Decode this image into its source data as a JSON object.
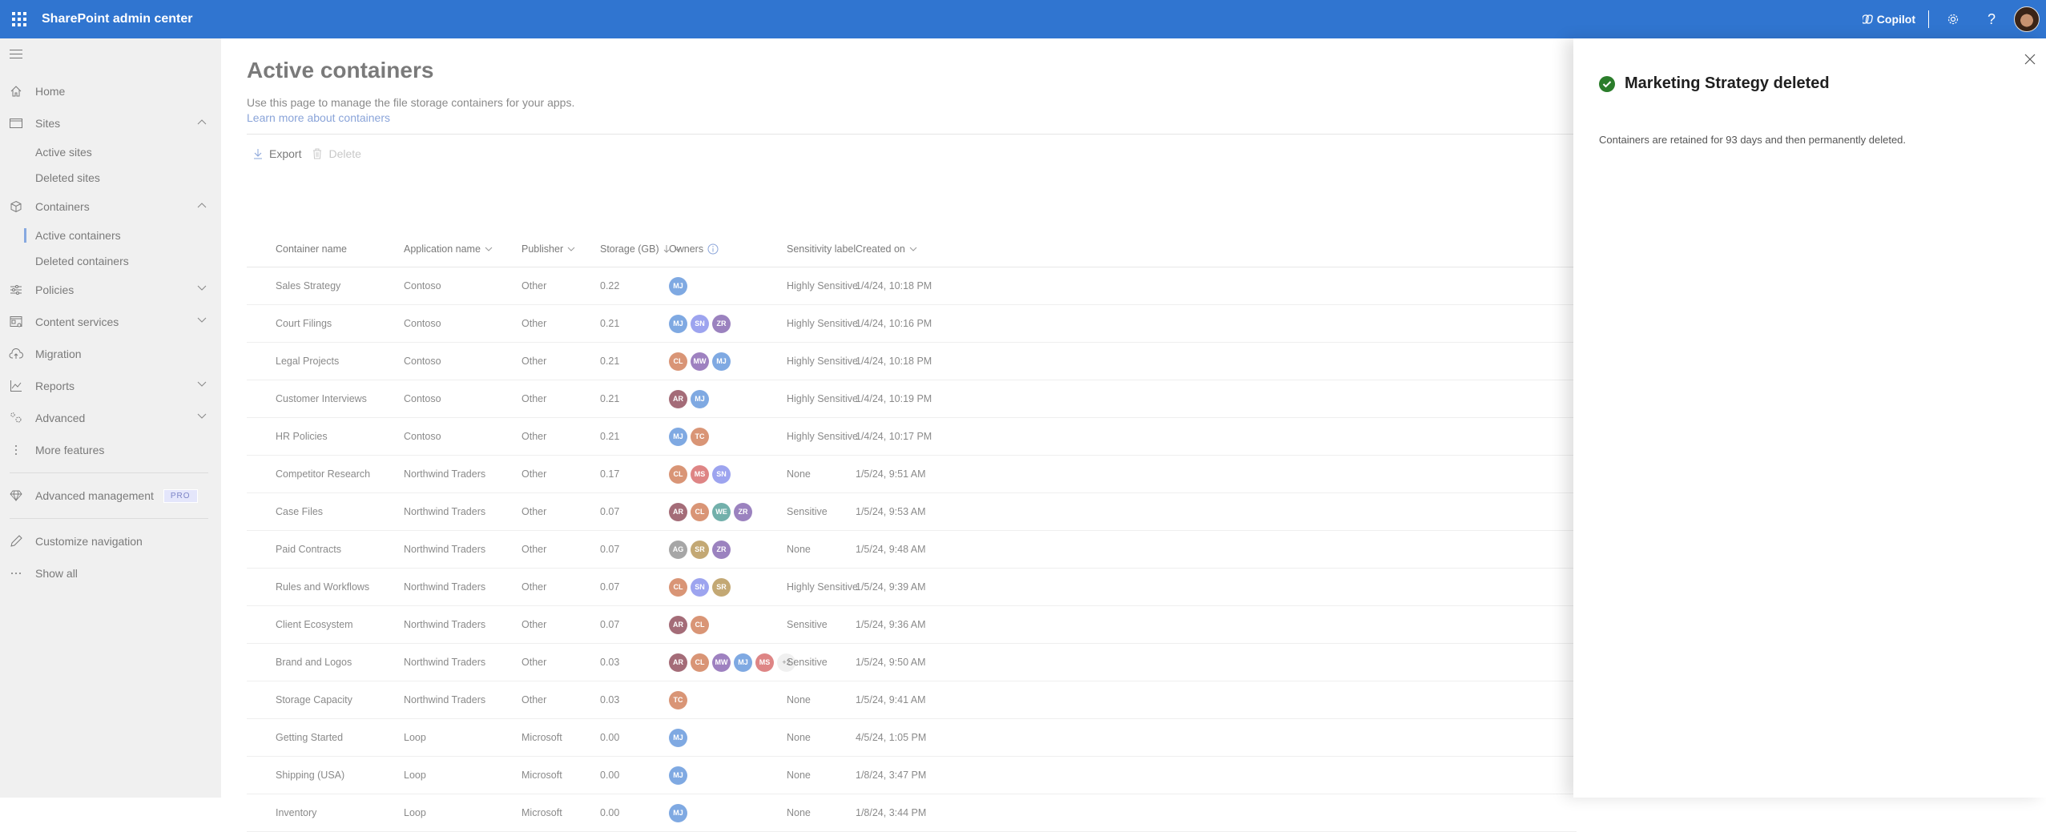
{
  "header": {
    "app_title": "SharePoint admin center",
    "copilot_label": "Copilot",
    "icons": [
      "app-launcher-icon",
      "copilot-icon",
      "settings-icon",
      "help-icon",
      "user-avatar"
    ],
    "brand_color": "#3075d0"
  },
  "sidebar": {
    "items": [
      {
        "label": "Home",
        "icon": "home-icon"
      },
      {
        "label": "Sites",
        "icon": "sites-icon",
        "expanded": true,
        "children": [
          {
            "label": "Active sites"
          },
          {
            "label": "Deleted sites"
          }
        ]
      },
      {
        "label": "Containers",
        "icon": "containers-icon",
        "expanded": true,
        "children": [
          {
            "label": "Active containers",
            "active": true
          },
          {
            "label": "Deleted containers"
          }
        ]
      },
      {
        "label": "Policies",
        "icon": "policies-icon",
        "expanded": false
      },
      {
        "label": "Content services",
        "icon": "content-services-icon",
        "expanded": false
      },
      {
        "label": "Migration",
        "icon": "migration-icon"
      },
      {
        "label": "Reports",
        "icon": "reports-icon",
        "expanded": false
      },
      {
        "label": "Advanced",
        "icon": "advanced-icon",
        "expanded": false
      },
      {
        "label": "More features",
        "icon": "more-features-icon"
      }
    ],
    "advanced_management": {
      "label": "Advanced management",
      "badge": "PRO"
    },
    "customize_navigation": "Customize navigation",
    "show_all": "Show all"
  },
  "main": {
    "title": "Active containers",
    "description": "Use this page to manage the file storage containers for your apps.",
    "learn_link": "Learn more about containers",
    "toolbar": {
      "export_label": "Export",
      "delete_label": "Delete"
    },
    "columns": {
      "name": "Container name",
      "app": "Application name",
      "publisher": "Publisher",
      "storage": "Storage (GB)",
      "owners": "Owners",
      "sensitivity": "Sensitivity label",
      "created": "Created on"
    },
    "rows": [
      {
        "name": "Sales Strategy",
        "app": "Contoso",
        "publisher": "Other",
        "storage": "0.22",
        "owners": [
          "MJ"
        ],
        "sensitivity": "Highly Sensitive",
        "created": "1/4/24, 10:18 PM"
      },
      {
        "name": "Court Filings",
        "app": "Contoso",
        "publisher": "Other",
        "storage": "0.21",
        "owners": [
          "MJ",
          "SN",
          "ZR"
        ],
        "sensitivity": "Highly Sensitive",
        "created": "1/4/24, 10:16 PM"
      },
      {
        "name": "Legal Projects",
        "app": "Contoso",
        "publisher": "Other",
        "storage": "0.21",
        "owners": [
          "CL",
          "MW",
          "MJ"
        ],
        "sensitivity": "Highly Sensitive",
        "created": "1/4/24, 10:18 PM"
      },
      {
        "name": "Customer Interviews",
        "app": "Contoso",
        "publisher": "Other",
        "storage": "0.21",
        "owners": [
          "AR",
          "MJ"
        ],
        "sensitivity": "Highly Sensitive",
        "created": "1/4/24, 10:19 PM"
      },
      {
        "name": "HR Policies",
        "app": "Contoso",
        "publisher": "Other",
        "storage": "0.21",
        "owners": [
          "MJ",
          "TC"
        ],
        "sensitivity": "Highly Sensitive",
        "created": "1/4/24, 10:17 PM"
      },
      {
        "name": "Competitor Research",
        "app": "Northwind Traders",
        "publisher": "Other",
        "storage": "0.17",
        "owners": [
          "CL",
          "MS",
          "SN"
        ],
        "sensitivity": "None",
        "created": "1/5/24, 9:51 AM"
      },
      {
        "name": "Case Files",
        "app": "Northwind Traders",
        "publisher": "Other",
        "storage": "0.07",
        "owners": [
          "AR",
          "CL",
          "WE",
          "ZR"
        ],
        "sensitivity": "Sensitive",
        "created": "1/5/24, 9:53 AM"
      },
      {
        "name": "Paid Contracts",
        "app": "Northwind Traders",
        "publisher": "Other",
        "storage": "0.07",
        "owners": [
          "AG",
          "SR",
          "ZR"
        ],
        "sensitivity": "None",
        "created": "1/5/24, 9:48 AM"
      },
      {
        "name": "Rules and Workflows",
        "app": "Northwind Traders",
        "publisher": "Other",
        "storage": "0.07",
        "owners": [
          "CL",
          "SN",
          "SR"
        ],
        "sensitivity": "Highly Sensitive",
        "created": "1/5/24, 9:39 AM"
      },
      {
        "name": "Client Ecosystem",
        "app": "Northwind Traders",
        "publisher": "Other",
        "storage": "0.07",
        "owners": [
          "AR",
          "CL"
        ],
        "sensitivity": "Sensitive",
        "created": "1/5/24, 9:36 AM"
      },
      {
        "name": "Brand and Logos",
        "app": "Northwind Traders",
        "publisher": "Other",
        "storage": "0.03",
        "owners": [
          "AR",
          "CL",
          "MW",
          "MJ",
          "MS"
        ],
        "owners_more": "+2",
        "sensitivity": "Sensitive",
        "created": "1/5/24, 9:50 AM"
      },
      {
        "name": "Storage Capacity",
        "app": "Northwind Traders",
        "publisher": "Other",
        "storage": "0.03",
        "owners": [
          "TC"
        ],
        "sensitivity": "None",
        "created": "1/5/24, 9:41 AM"
      },
      {
        "name": "Getting Started",
        "app": "Loop",
        "publisher": "Microsoft",
        "storage": "0.00",
        "owners": [
          "MJ"
        ],
        "sensitivity": "None",
        "created": "4/5/24, 1:05 PM"
      },
      {
        "name": "Shipping (USA)",
        "app": "Loop",
        "publisher": "Microsoft",
        "storage": "0.00",
        "owners": [
          "MJ"
        ],
        "sensitivity": "None",
        "created": "1/8/24, 3:47 PM"
      },
      {
        "name": "Inventory",
        "app": "Loop",
        "publisher": "Microsoft",
        "storage": "0.00",
        "owners": [
          "MJ"
        ],
        "sensitivity": "None",
        "created": "1/8/24, 3:44 PM"
      }
    ],
    "avatar_colors": {
      "MJ": "#7fa9e2",
      "SN": "#9da4ef",
      "ZR": "#9b82bf",
      "CL": "#d99576",
      "MW": "#9e81c0",
      "AR": "#a46c78",
      "TC": "#d99576",
      "MS": "#de8585",
      "WE": "#72b0ab",
      "AG": "#a6a6a6",
      "SR": "#c3a874"
    }
  },
  "panel": {
    "title": "Marketing Strategy deleted",
    "message": "Containers are retained for 93 days and then permanently deleted.",
    "success_color": "#2b7d2b"
  }
}
